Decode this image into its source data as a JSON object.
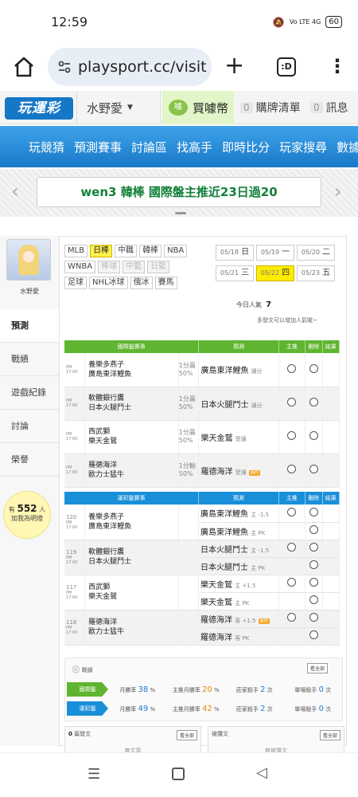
{
  "status": {
    "time": "12:59",
    "battery": "60",
    "signal": "Vo LTE 4G"
  },
  "browser": {
    "url": "playsport.cc/visit"
  },
  "site": {
    "logo": "玩運彩",
    "user": "水野愛",
    "coins_label": "買噱幣",
    "coin_icon": "噱",
    "cart_count": "0",
    "cart_label": "購牌清單",
    "msg_count": "0",
    "msg_label": "訊息"
  },
  "nav": [
    "玩競猜",
    "預測賽事",
    "討論區",
    "找高手",
    "即時比分",
    "玩家搜尋",
    "數據"
  ],
  "marquee": "wen3 韓棒 國際盤主推近23日過20",
  "sidebar": {
    "username": "水野愛",
    "items": [
      "預測",
      "戰績",
      "遊戲紀錄",
      "討論",
      "榮譽"
    ],
    "bulb_pre": "有",
    "bulb_count": "552",
    "bulb_post": "人",
    "bulb_line2": "加我為明燈"
  },
  "categories": [
    {
      "label": "MLB",
      "state": "normal"
    },
    {
      "label": "日棒",
      "state": "selected"
    },
    {
      "label": "中職",
      "state": "normal"
    },
    {
      "label": "韓棒",
      "state": "normal"
    },
    {
      "label": "NBA",
      "state": "normal"
    },
    {
      "label": "WNBA",
      "state": "normal"
    },
    {
      "label": "棒球",
      "state": "disabled"
    },
    {
      "label": "中籃",
      "state": "disabled"
    },
    {
      "label": "日籃",
      "state": "disabled"
    },
    {
      "label": "足球",
      "state": "normal"
    },
    {
      "label": "NHL冰球",
      "state": "normal"
    },
    {
      "label": "俄冰",
      "state": "normal"
    },
    {
      "label": "賽馬",
      "state": "normal"
    }
  ],
  "dates": [
    {
      "d": "05/18",
      "w": "日"
    },
    {
      "d": "05/19",
      "w": "一"
    },
    {
      "d": "05/20",
      "w": "二"
    },
    {
      "d": "05/21",
      "w": "三"
    },
    {
      "d": "05/22",
      "w": "四"
    },
    {
      "d": "05/23",
      "w": "五"
    }
  ],
  "popularity": {
    "label": "今日人氣",
    "value": "7",
    "hint": "多發文可以增加人氣喔~"
  },
  "intl_table": {
    "headers": [
      "國際盤賽事",
      "預測",
      "主推",
      "刪除",
      "結果"
    ],
    "rows": [
      {
        "time": "PM 17:00",
        "away": "養樂多燕子",
        "home": "廣島東洋鯉魚",
        "odds1": "1分贏",
        "odds2": "50%",
        "pick": "廣島東洋鯉魚",
        "pick_note": "讓分",
        "hot": ""
      },
      {
        "time": "PM 17:00",
        "away": "軟體銀行鷹",
        "home": "日本火腿鬥士",
        "odds1": "1分贏",
        "odds2": "50%",
        "pick": "日本火腿鬥士",
        "pick_note": "讓分",
        "hot": ""
      },
      {
        "time": "PM 17:00",
        "away": "西武獅",
        "home": "樂天金鷲",
        "odds1": "1分贏",
        "odds2": "50%",
        "pick": "樂天金鷲",
        "pick_note": "受讓",
        "hot": ""
      },
      {
        "time": "PM 17:00",
        "away": "羅德海洋",
        "home": "歐力士猛牛",
        "odds1": "1分輸",
        "odds2": "50%",
        "pick": "羅德海洋",
        "pick_note": "受讓",
        "hot": "熱門"
      }
    ]
  },
  "tw_table": {
    "headers": [
      "運彩盤賽事",
      "預測",
      "主推",
      "刪除",
      "結果"
    ],
    "rows": [
      {
        "num": "120",
        "time": "PM 17:00",
        "away": "養樂多燕子",
        "home": "廣島東洋鯉魚",
        "pick1": "廣島東洋鯉魚",
        "note1": "主 -1.5",
        "pick2": "廣島東洋鯉魚",
        "note2": "主 PK",
        "hot": ""
      },
      {
        "num": "119",
        "time": "PM 17:00",
        "away": "軟體銀行鷹",
        "home": "日本火腿鬥士",
        "pick1": "日本火腿鬥士",
        "note1": "主 -1.5",
        "pick2": "日本火腿鬥士",
        "note2": "主 PK",
        "hot": ""
      },
      {
        "num": "117",
        "time": "PM 17:00",
        "away": "西武獅",
        "home": "樂天金鷲",
        "pick1": "樂天金鷲",
        "note1": "主 +1.5",
        "pick2": "樂天金鷲",
        "note2": "主 PK",
        "hot": ""
      },
      {
        "num": "118",
        "time": "PM 17:00",
        "away": "羅德海洋",
        "home": "歐力士猛牛",
        "pick1": "羅德海洋",
        "note1": "客 +1.5",
        "pick2": "羅德海洋",
        "note2": "客 PK",
        "hot": "熱門"
      }
    ]
  },
  "stats": {
    "title": "戰績",
    "more": "看全部",
    "rows": [
      {
        "badge": "國際盤",
        "c1_label": "月勝率",
        "c1_val": "38",
        "c1_unit": "%",
        "c2_label": "主推月勝率",
        "c2_val": "20",
        "c2_unit": "%",
        "c3_label": "莊家殺手",
        "c3_val": "2",
        "c3_unit": "次",
        "c4_label": "單場殺手",
        "c4_val": "0",
        "c4_unit": "次",
        "color": "#5fb52f"
      },
      {
        "badge": "運彩盤",
        "c1_label": "月勝率",
        "c1_val": "49",
        "c1_unit": "%",
        "c2_label": "主推月勝率",
        "c2_val": "42",
        "c2_unit": "%",
        "c3_label": "莊家殺手",
        "c3_val": "2",
        "c3_unit": "次",
        "c4_label": "單場殺手",
        "c4_val": "0",
        "c4_unit": "次",
        "color": "#1a8fd9"
      }
    ]
  },
  "cards": [
    {
      "count": "0",
      "title": "篇發文",
      "more": "看全部",
      "empty": "無文章"
    },
    {
      "count": "",
      "title": "被讚文",
      "more": "看全部",
      "empty": "無被讚文"
    }
  ],
  "colors": {
    "nav_blue": "#1978c8",
    "intl_green": "#5fb52f",
    "tw_blue": "#1a8fd9",
    "selected_yellow": "#ffeb00",
    "marquee_green": "#13803a"
  }
}
